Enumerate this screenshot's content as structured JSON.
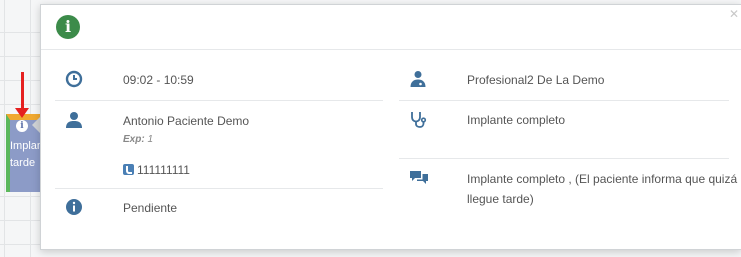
{
  "event": {
    "text_line1": "Implan",
    "text_line2": "tarde"
  },
  "popover": {
    "header_icon": "info-circle-icon",
    "close_icon": "close-icon",
    "left": {
      "time": "09:02 - 10:59",
      "patient_name": "Antonio Paciente Demo",
      "exp_label": "Exp:",
      "exp_value": "1",
      "phone": "111111111",
      "status": "Pendiente"
    },
    "right": {
      "professional": "Profesional2 De La Demo",
      "treatment": "Implante completo",
      "comment_line1": "Implante completo , (El paciente informa que quizá",
      "comment_line2": "llegue tarde)"
    }
  },
  "colors": {
    "header_icon_bg": "#3c8b4a",
    "row_icon": "#3f6f9a",
    "event_bg": "#8c9bc7",
    "event_top_bar": "#f0a830",
    "event_left_bar": "#5cb85c",
    "arrow": "#e52020"
  }
}
